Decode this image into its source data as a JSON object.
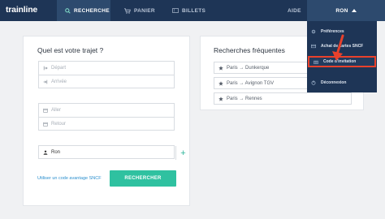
{
  "brand": "trainline",
  "nav": {
    "search": "RECHERCHE",
    "cart": "PANIER",
    "tickets": "BILLETS",
    "help": "AIDE",
    "user": "RON"
  },
  "dropdown": {
    "items": [
      {
        "label": "Préférences",
        "icon": "gear-icon"
      },
      {
        "label": "Achat de cartes SNCF",
        "icon": "card-icon"
      },
      {
        "label": "Code d'invitation",
        "icon": "gift-icon",
        "highlighted": true
      },
      {
        "label": "Déconnexion",
        "icon": "power-icon"
      }
    ]
  },
  "search_form": {
    "title": "Quel est votre trajet ?",
    "departure_placeholder": "Départ",
    "arrival_placeholder": "Arrivée",
    "outbound_placeholder": "Aller",
    "return_placeholder": "Retour",
    "passenger_value": "Ron",
    "advantage_link": "Utiliser un code avantage SNCF",
    "submit_label": "RECHERCHER"
  },
  "frequent": {
    "title": "Recherches fréquentes",
    "items": [
      "Paris → Dunkerque",
      "Paris → Avignon TGV",
      "Paris → Rennes"
    ]
  },
  "colors": {
    "nav_bg": "#1e3556",
    "accent": "#2fc1a0",
    "highlight": "#e8412c"
  }
}
